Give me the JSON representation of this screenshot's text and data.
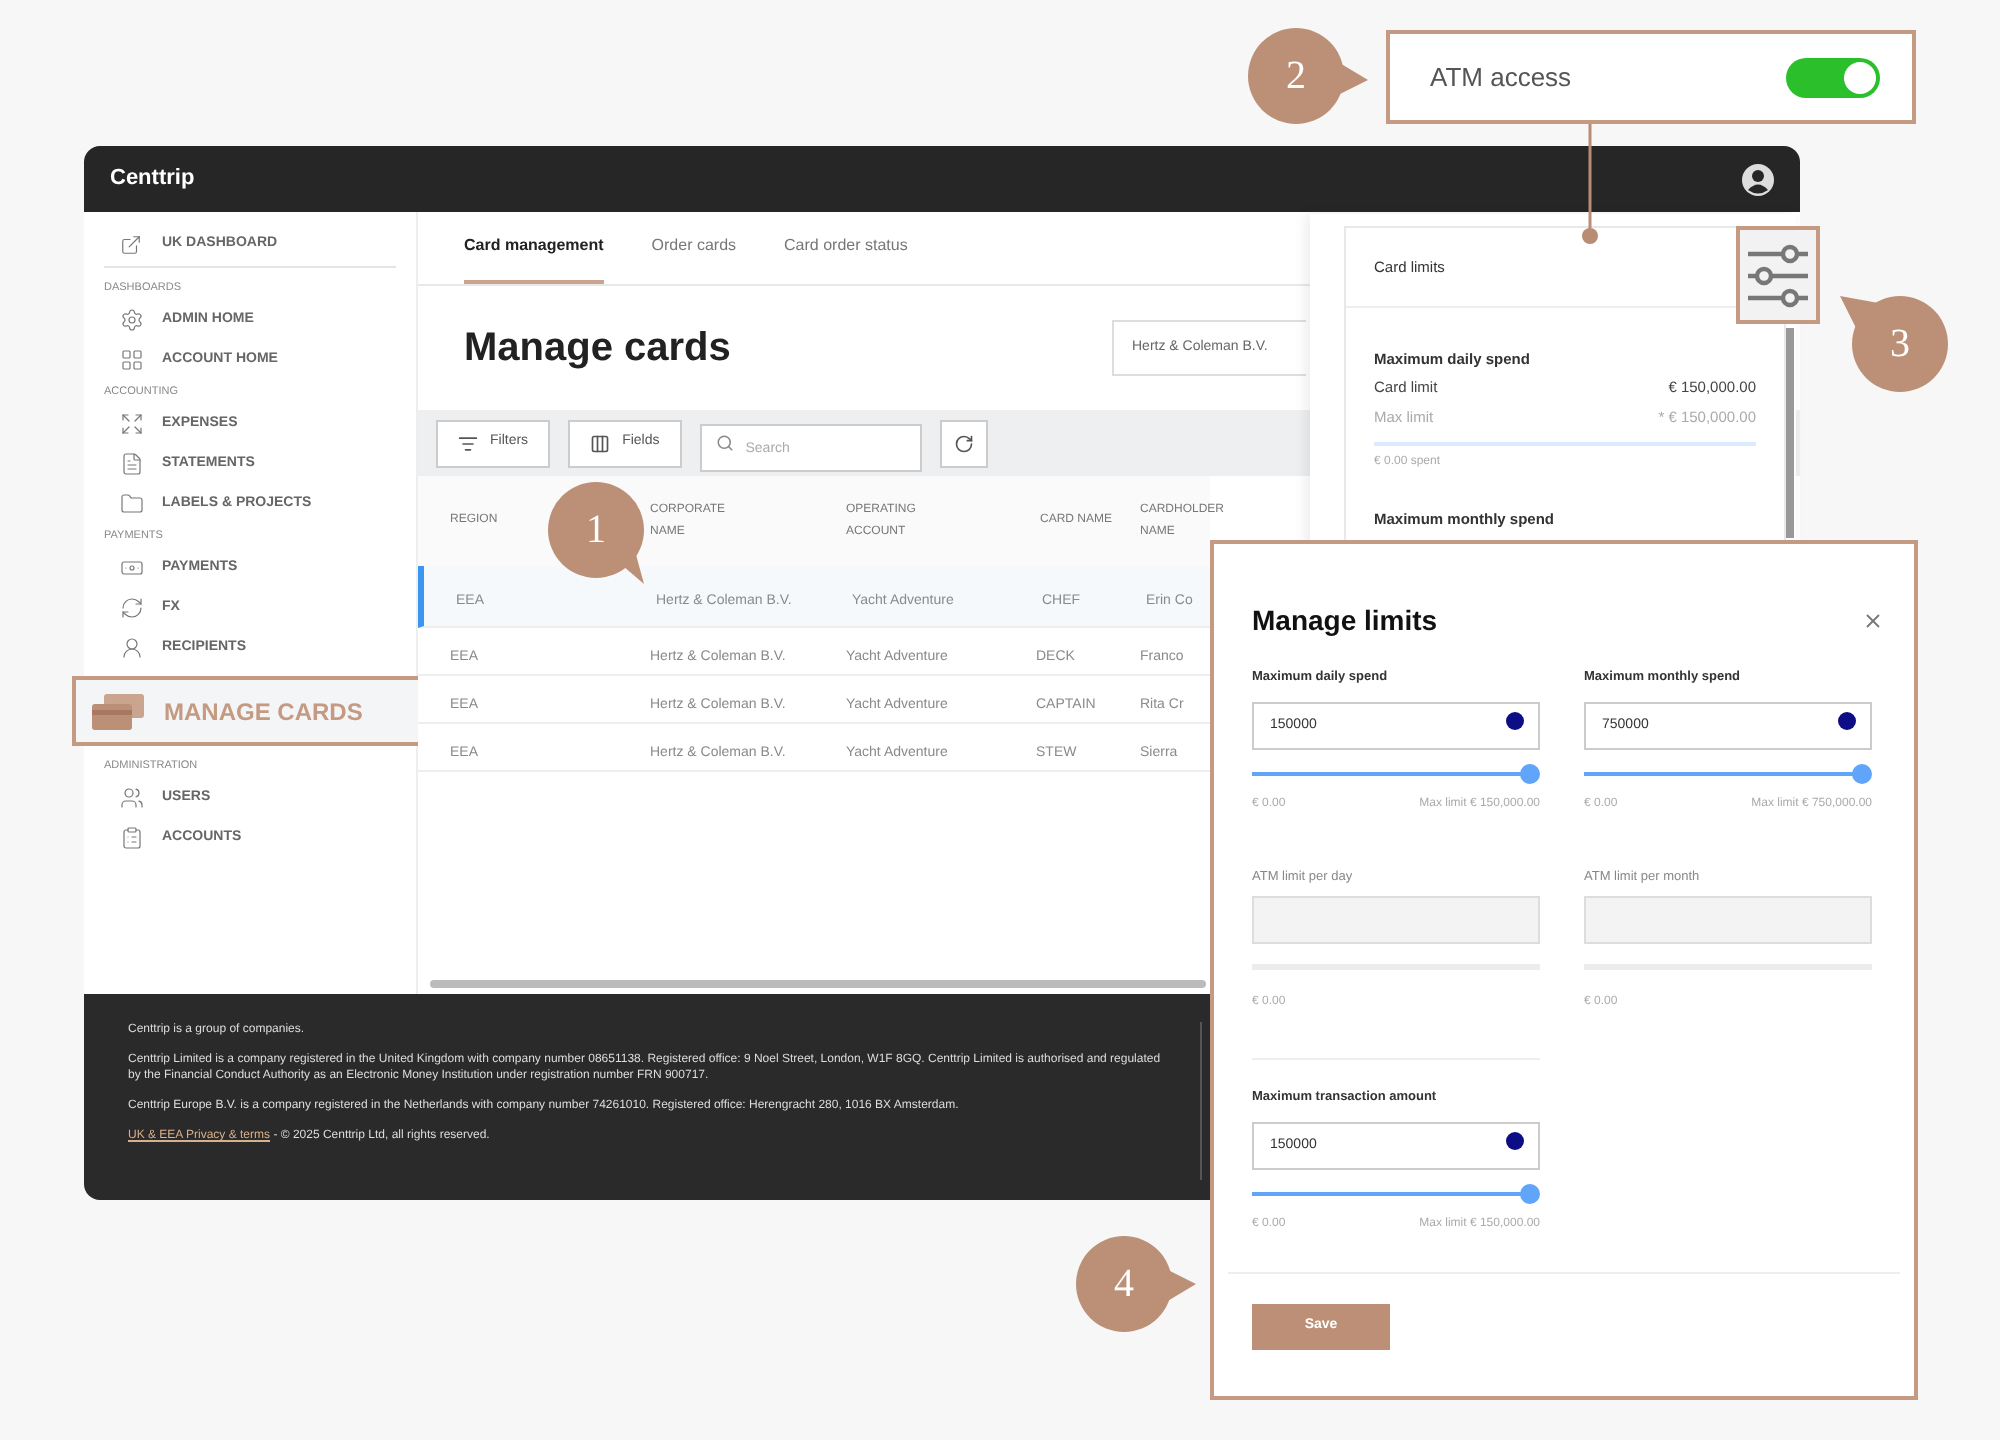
{
  "app": {
    "logo": "Centtrip"
  },
  "sidebar": {
    "top_link": "UK DASHBOARD",
    "sections": [
      {
        "kind": "section",
        "title": "DASHBOARDS",
        "items": [
          "ADMIN HOME",
          "ACCOUNT HOME"
        ]
      },
      {
        "kind": "section",
        "title": "ACCOUNTING",
        "items": [
          "EXPENSES",
          "STATEMENTS",
          "LABELS & PROJECTS"
        ]
      },
      {
        "kind": "section",
        "title": "PAYMENTS",
        "items": [
          "PAYMENTS",
          "FX",
          "RECIPIENTS"
        ]
      },
      {
        "kind": "highlight",
        "label": "MANAGE CARDS"
      },
      {
        "kind": "section",
        "title": "ADMINISTRATION",
        "items": [
          "USERS",
          "ACCOUNTS"
        ]
      }
    ]
  },
  "tabs": [
    {
      "label": "Card management",
      "selected": true
    },
    {
      "label": "Order cards",
      "selected": false
    },
    {
      "label": "Card order status",
      "selected": false
    }
  ],
  "title": "Manage cards",
  "company_select": {
    "value": "Hertz & Coleman B.V."
  },
  "toolbar": {
    "filters": "Filters",
    "fields": "Fields",
    "search_placeholder": "Search"
  },
  "table": {
    "columns": [
      "REGION",
      "CORPORATE NAME",
      "OPERATING ACCOUNT",
      "CARD NAME",
      "CARDHOLDER NAME"
    ],
    "rows": [
      {
        "cells": [
          "EEA",
          "Hertz & Coleman B.V.",
          "Yacht Adventure",
          "CHEF",
          "Erin Co"
        ],
        "selected": true
      },
      {
        "cells": [
          "EEA",
          "Hertz & Coleman B.V.",
          "Yacht Adventure",
          "DECK",
          "Franco"
        ],
        "selected": false
      },
      {
        "cells": [
          "EEA",
          "Hertz & Coleman B.V.",
          "Yacht Adventure",
          "CAPTAIN",
          "Rita Cr"
        ],
        "selected": false
      },
      {
        "cells": [
          "EEA",
          "Hertz & Coleman B.V.",
          "Yacht Adventure",
          "STEW",
          "Sierra"
        ],
        "selected": false
      }
    ]
  },
  "footer": {
    "paragraphs": [
      "Centtrip is a group of companies.",
      "Centtrip Limited is a company registered in the United Kingdom with company number 08651138. Registered office: 9 Noel Street, London, W1F 8GQ. Centtrip Limited is authorised and regulated by the Financial Conduct Authority as an Electronic Money Institution under registration number FRN 900717.",
      "Centtrip Europe B.V. is a company registered in the Netherlands with company number 74261010. Registered office: Herengracht 280, 1016 BX Amsterdam."
    ],
    "link": "UK & EEA Privacy & terms",
    "rights": " - © 2025 Centtrip Ltd, all rights reserved."
  },
  "card_limits": {
    "title": "Card limits",
    "sections": [
      {
        "title": "Maximum daily spend",
        "card_limit_label": "Card limit",
        "card_limit": "€ 150,000.00",
        "max_limit_label": "Max limit",
        "max_limit": "* € 150,000.00",
        "level": 0,
        "spent": "€ 0.00 spent"
      }
    ],
    "next_section": "Maximum monthly spend"
  },
  "atm_access": {
    "label": "ATM access",
    "on": true
  },
  "modal": {
    "title": "Manage limits",
    "rows": [
      [
        {
          "kind": "slider",
          "label": "Maximum daily spend",
          "value": "150000",
          "level": 1,
          "min": "€ 0.00",
          "max": "Max limit € 150,000.00"
        },
        {
          "kind": "slider",
          "label": "Maximum monthly spend",
          "value": "750000",
          "level": 1,
          "min": "€ 0.00",
          "max": "Max limit € 750,000.00"
        }
      ],
      [
        {
          "kind": "atm",
          "label": "ATM limit per day",
          "min": "€ 0.00"
        },
        {
          "kind": "atm",
          "label": "ATM limit per month",
          "min": "€ 0.00"
        }
      ],
      [
        {
          "kind": "slider",
          "label": "Maximum transaction amount",
          "value": "150000",
          "level": 1,
          "min": "€ 0.00",
          "max": "Max limit € 150,000.00"
        }
      ]
    ],
    "save": "Save"
  },
  "callouts": [
    "1",
    "2",
    "3",
    "4"
  ]
}
